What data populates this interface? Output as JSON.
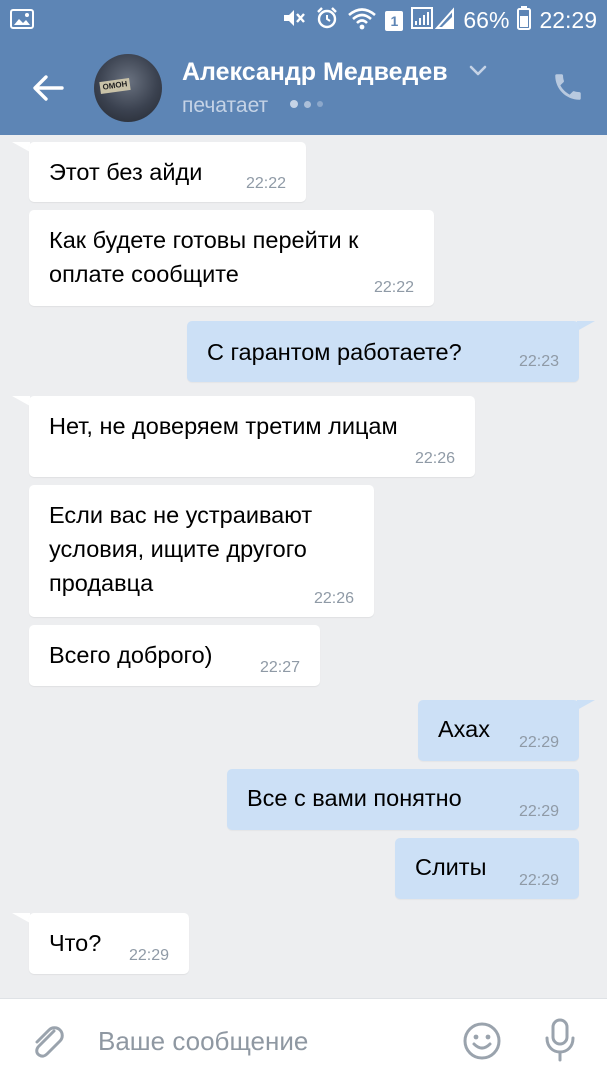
{
  "status_bar": {
    "notification_count": "1",
    "battery": "66%",
    "time": "22:29"
  },
  "header": {
    "contact_name": "Александр Медведев",
    "status": "печатает",
    "avatar_badge": "ОМОН"
  },
  "messages": [
    {
      "direction": "in",
      "text": "Этот без айди",
      "time": "22:22"
    },
    {
      "direction": "in",
      "text": "Как будете готовы перейти к оплате сообщите",
      "time": "22:22"
    },
    {
      "direction": "out",
      "text": "С гарантом работаете?",
      "time": "22:23"
    },
    {
      "direction": "in",
      "text": "Нет, не доверяем третим лицам",
      "time": "22:26"
    },
    {
      "direction": "in",
      "text": "Если вас не устраивают условия, ищите другого продавца",
      "time": "22:26"
    },
    {
      "direction": "in",
      "text": "Всего доброго)",
      "time": "22:27"
    },
    {
      "direction": "out",
      "text": "Ахах",
      "time": "22:29"
    },
    {
      "direction": "out",
      "text": "Все с вами понятно",
      "time": "22:29"
    },
    {
      "direction": "out",
      "text": "Слиты",
      "time": "22:29"
    },
    {
      "direction": "in",
      "text": "Что?",
      "time": "22:29"
    }
  ],
  "composer": {
    "placeholder": "Ваше сообщение"
  },
  "colors": {
    "header": "#5d85b5",
    "background": "#edeef0",
    "incoming_bubble": "#ffffff",
    "outgoing_bubble": "#cce0f6",
    "icon_gray": "#9aa3ad"
  }
}
